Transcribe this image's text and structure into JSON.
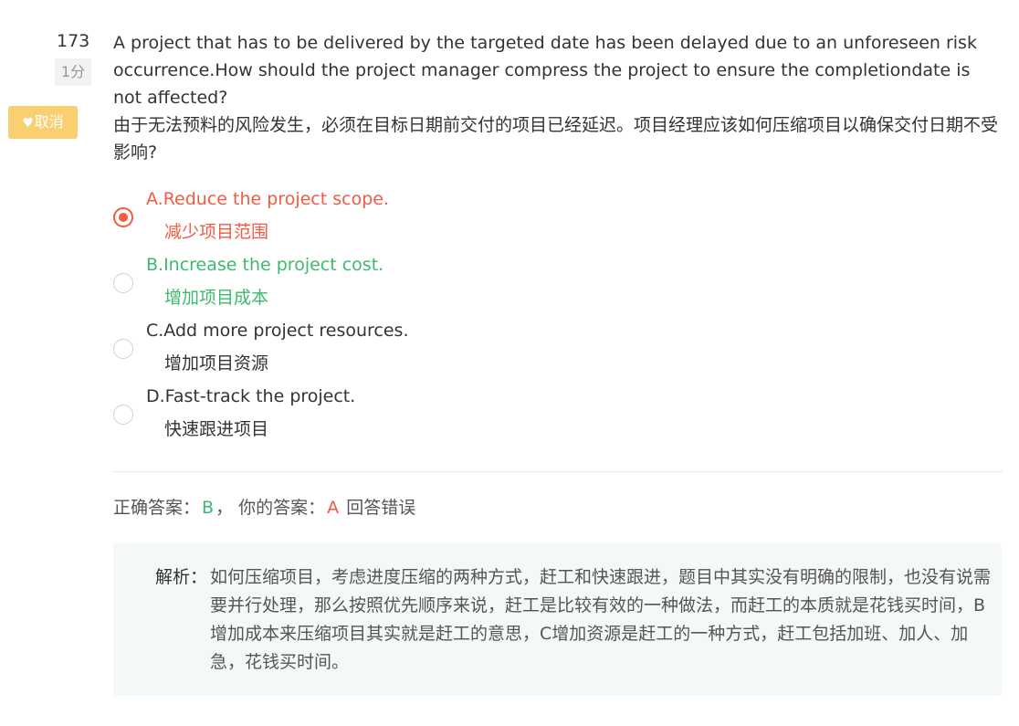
{
  "question": {
    "number": "173",
    "score": "1分",
    "favorite_label": "取消",
    "text_en": "A project that has to be delivered by the targeted date has been delayed due to an unforeseen risk occurrence.How should the project manager compress the project to ensure the completiondate is not affected?",
    "text_zh": "由于无法预料的风险发生，必须在目标日期前交付的项目已经延迟。项目经理应该如何压缩项目以确保交付日期不受影响?"
  },
  "options": [
    {
      "en": "A.Reduce the project scope.",
      "zh": "减少项目范围",
      "state": "selected-wrong"
    },
    {
      "en": "B.Increase the project cost.",
      "zh": "增加项目成本",
      "state": "correct"
    },
    {
      "en": "C.Add more project resources.",
      "zh": "增加项目资源",
      "state": "normal"
    },
    {
      "en": "D.Fast-track the project.",
      "zh": "快速跟进项目",
      "state": "normal"
    }
  ],
  "result": {
    "correct_label": "正确答案：",
    "correct_value": "B",
    "separator": "，",
    "your_label": "你的答案：",
    "your_value": "A",
    "status": "回答错误"
  },
  "analysis": {
    "label": "解析：",
    "text": "如何压缩项目，考虑进度压缩的两种方式，赶工和快速跟进，题目中其实没有明确的限制，也没有说需要并行处理，那么按照优先顺序来说，赶工是比较有效的一种做法，而赶工的本质就是花钱买时间，B增加成本来压缩项目其实就是赶工的意思，C增加资源是赶工的一种方式，赶工包括加班、加人、加急，花钱买时间。"
  },
  "colors": {
    "wrong": "#f35a43",
    "correct": "#3cba6e",
    "favorite": "#f8cf71",
    "analysis_bg": "#f4f9f6"
  }
}
